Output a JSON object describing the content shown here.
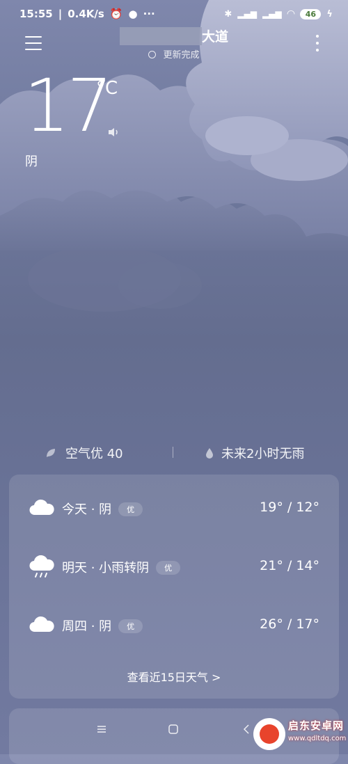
{
  "status_bar": {
    "time": "15:55",
    "speed": "0.4K/s",
    "battery": "46"
  },
  "header": {
    "location_suffix": "大道",
    "update_text": "更新完成"
  },
  "current": {
    "temperature": "17",
    "unit": "°C",
    "condition": "阴"
  },
  "air": {
    "quality": "空气优 40",
    "rain": "未来2小时无雨"
  },
  "forecast": [
    {
      "day": "今天 · 阴",
      "badge": "优",
      "range": "19° / 12°",
      "icon": "cloud-icon"
    },
    {
      "day": "明天 · 小雨转阴",
      "badge": "优",
      "range": "21° / 14°",
      "icon": "rain-cloud-icon"
    },
    {
      "day": "周四 · 阴",
      "badge": "优",
      "range": "26° / 17°",
      "icon": "cloud-icon"
    }
  ],
  "more_link": "查看近15日天气  >",
  "watermark": {
    "title": "启东安卓网",
    "url": "www.qdltdq.com"
  },
  "colors": {
    "background": "#6a7398",
    "cloud": "#a3a8c6"
  }
}
